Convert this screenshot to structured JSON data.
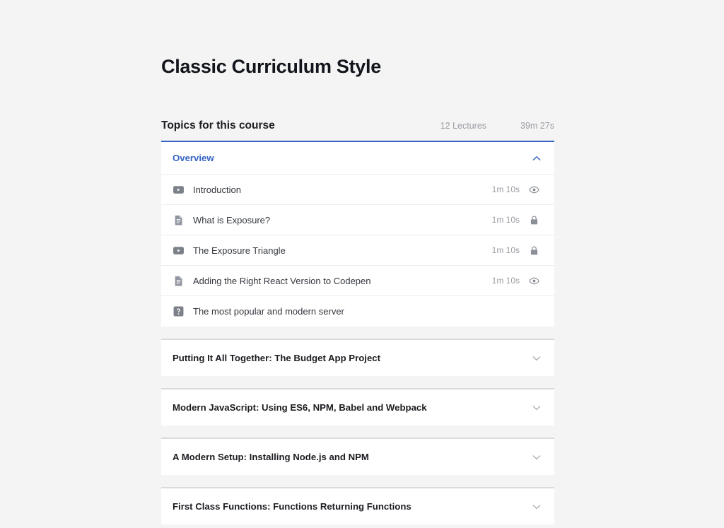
{
  "page": {
    "title": "Classic Curriculum Style",
    "background_color": "#f4f4f4"
  },
  "colors": {
    "accent_blue": "#3563c4",
    "text_dark": "#1b1d21",
    "text_muted": "#9a9da3",
    "card_white": "#ffffff",
    "border_gray": "#d9dadd"
  },
  "topics": {
    "heading": "Topics for this course",
    "lecture_count": "12 Lectures",
    "total_duration": "39m 27s"
  },
  "sections": [
    {
      "title": "Overview",
      "expanded": true,
      "chevron": "chevron-up-icon",
      "lessons": [
        {
          "title": "Introduction",
          "icon": "video-icon",
          "duration": "1m 10s",
          "status": "eye-icon"
        },
        {
          "title": "What is Exposure?",
          "icon": "document-icon",
          "duration": "1m 10s",
          "status": "lock-icon"
        },
        {
          "title": "The Exposure Triangle",
          "icon": "video-icon",
          "duration": "1m 10s",
          "status": "lock-icon"
        },
        {
          "title": "Adding the Right React Version to Codepen",
          "icon": "document-icon",
          "duration": "1m 10s",
          "status": "eye-icon"
        },
        {
          "title": "The most popular and modern server",
          "icon": "quiz-icon",
          "duration": "",
          "status": ""
        }
      ]
    },
    {
      "title": "Putting It All Together: The Budget App Project",
      "expanded": false,
      "chevron": "chevron-down-icon",
      "lessons": []
    },
    {
      "title": "Modern JavaScript: Using ES6, NPM, Babel and Webpack",
      "expanded": false,
      "chevron": "chevron-down-icon",
      "lessons": []
    },
    {
      "title": "A Modern Setup: Installing Node.js and NPM",
      "expanded": false,
      "chevron": "chevron-down-icon",
      "lessons": []
    },
    {
      "title": "First Class Functions: Functions Returning Functions",
      "expanded": false,
      "chevron": "chevron-down-icon",
      "lessons": []
    }
  ]
}
